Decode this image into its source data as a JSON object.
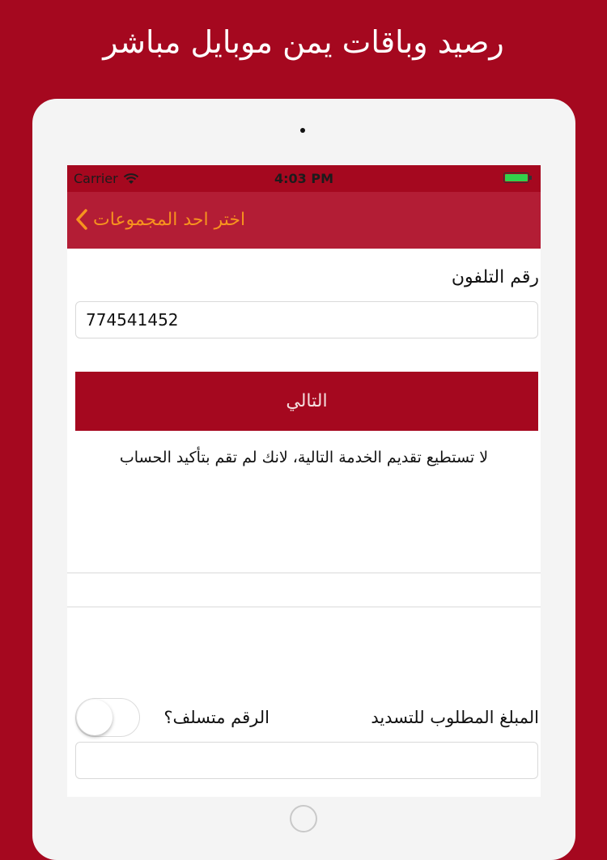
{
  "promo": {
    "title": "رصيد وباقات يمن موبايل مباشر"
  },
  "status_bar": {
    "carrier": "Carrier",
    "time": "4:03 PM"
  },
  "nav": {
    "back_label": "اختر احد المجموعات"
  },
  "form": {
    "phone_label": "رقم التلفون",
    "phone_value": "774541452",
    "next_label": "التالي",
    "notice": "لا تستطيع تقديم الخدمة التالية، لانك لم تقم بتأكيد الحساب",
    "amount_label": "المبلغ المطلوب للتسديد",
    "subscribed_label": "الرقم متسلف؟",
    "subscribed_toggle_on": false,
    "amount_value": ""
  },
  "colors": {
    "brand_red": "#a5081f",
    "nav_red": "#b31d35",
    "accent_orange": "#f7931e",
    "battery_green": "#32d14b"
  }
}
